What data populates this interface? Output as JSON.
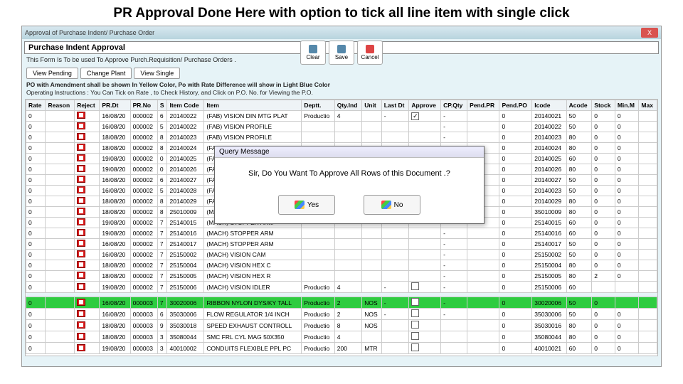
{
  "slide": {
    "title": "PR Approval Done Here with option to tick all line item with single click"
  },
  "titlebar": {
    "text": "Approval of Purchase Indent/ Purchase Order",
    "close": "X"
  },
  "form": {
    "header": "Purchase Indent Approval",
    "sub": "This Form Is To be used To Approve Purch.Requisition/ Purchase Orders .",
    "note1": "PO with Amendment shall be shown In Yellow Color, Po with Rate Difference will show in Light Blue Color",
    "note2": "Operating Instructions : You Can Tick on Rate , to Check History, and Click on P.O. No. for Viewing the P.O."
  },
  "toolbar": {
    "clear": "Clear",
    "save": "Save",
    "cancel": "Cancel"
  },
  "views": {
    "pending": "View Pending",
    "change": "Change Plant",
    "single": "View Single"
  },
  "dialog": {
    "title": "Query Message",
    "msg": "Sir, Do You Want To Approve All Rows of this Document .?",
    "yes": "Yes",
    "no": "No"
  },
  "cols": [
    "Rate",
    "Reason",
    "Reject",
    "PR.Dt",
    "PR.No",
    "S",
    "Item Code",
    "Item",
    "Deptt.",
    "Qty.Ind",
    "Unit",
    "Last Dt",
    "Approve",
    "CP.Qty",
    "Pend.PR",
    "Pend.PO",
    "Icode",
    "Acode",
    "Stock",
    "Min.M",
    "Max"
  ],
  "rows": [
    {
      "c": [
        "0",
        "",
        "",
        "16/08/20",
        "000002",
        "6",
        "20140022",
        "(FAB) VISION DIN MTG PLAT",
        "Productio",
        "4",
        "",
        "-",
        "✓",
        "-",
        "",
        "0",
        "20140021",
        "50",
        "0",
        "0",
        ""
      ]
    },
    {
      "c": [
        "0",
        "",
        "",
        "16/08/20",
        "000002",
        "5",
        "20140022",
        "(FAB) VISION PROFILE",
        "",
        "",
        "",
        "",
        "",
        "-",
        "",
        "0",
        "20140022",
        "50",
        "0",
        "0",
        ""
      ]
    },
    {
      "c": [
        "0",
        "",
        "",
        "18/08/20",
        "000002",
        "8",
        "20140023",
        "(FAB) VISION PROFILE",
        "",
        "",
        "",
        "",
        "",
        "-",
        "",
        "0",
        "20140023",
        "80",
        "0",
        "0",
        ""
      ]
    },
    {
      "c": [
        "0",
        "",
        "",
        "18/08/20",
        "000002",
        "8",
        "20140024",
        "(FAB) VISION RAIL 3L",
        "",
        "",
        "",
        "",
        "",
        "-",
        "",
        "0",
        "20140024",
        "80",
        "0",
        "0",
        ""
      ]
    },
    {
      "c": [
        "0",
        "",
        "",
        "19/08/20",
        "000002",
        "0",
        "20140025",
        "(FAB) VISION RAIL M",
        "",
        "",
        "",
        "",
        "",
        "-",
        "",
        "0",
        "20140025",
        "60",
        "0",
        "0",
        ""
      ]
    },
    {
      "c": [
        "0",
        "",
        "",
        "19/08/20",
        "000002",
        "0",
        "20140026",
        "(FAB) VISION SENSO",
        "",
        "",
        "",
        "",
        "",
        "-",
        "",
        "0",
        "20140026",
        "80",
        "0",
        "0",
        ""
      ]
    },
    {
      "c": [
        "0",
        "",
        "",
        "16/08/20",
        "000002",
        "6",
        "20140027",
        "(FAB) VISION SUN LT",
        "",
        "",
        "",
        "",
        "",
        "-",
        "",
        "0",
        "20140027",
        "50",
        "0",
        "0",
        ""
      ]
    },
    {
      "c": [
        "0",
        "",
        "",
        "16/08/20",
        "000002",
        "5",
        "20140028",
        "(FAB) VISION SUN RT",
        "",
        "",
        "",
        "",
        "",
        "-",
        "",
        "0",
        "20140023",
        "50",
        "0",
        "0",
        ""
      ]
    },
    {
      "c": [
        "0",
        "",
        "",
        "18/08/20",
        "000002",
        "8",
        "20140029",
        "(FAB) VISION TOP MN",
        "",
        "",
        "",
        "",
        "",
        "-",
        "",
        "0",
        "20140029",
        "80",
        "0",
        "0",
        ""
      ]
    },
    {
      "c": [
        "0",
        "",
        "",
        "18/08/20",
        "000002",
        "8",
        "25010009",
        "(MACH) REJECTION IG",
        "",
        "",
        "",
        "",
        "",
        "-",
        "",
        "0",
        "35010009",
        "80",
        "0",
        "0",
        ""
      ]
    },
    {
      "c": [
        "0",
        "",
        "",
        "19/08/20",
        "000002",
        "7",
        "25140015",
        "(MACH) STOPPER ARM",
        "",
        "",
        "",
        "",
        "",
        "-",
        "",
        "0",
        "25140015",
        "60",
        "0",
        "0",
        ""
      ]
    },
    {
      "c": [
        "0",
        "",
        "",
        "19/08/20",
        "000002",
        "7",
        "25140016",
        "(MACH) STOPPER ARM",
        "",
        "",
        "",
        "",
        "",
        "-",
        "",
        "0",
        "25140016",
        "60",
        "0",
        "0",
        ""
      ]
    },
    {
      "c": [
        "0",
        "",
        "",
        "16/08/20",
        "000002",
        "7",
        "25140017",
        "(MACH) STOPPER ARM",
        "",
        "",
        "",
        "",
        "",
        "-",
        "",
        "0",
        "25140017",
        "50",
        "0",
        "0",
        ""
      ]
    },
    {
      "c": [
        "0",
        "",
        "",
        "16/08/20",
        "000002",
        "7",
        "25150002",
        "(MACH) VISION CAM",
        "",
        "",
        "",
        "",
        "",
        "-",
        "",
        "0",
        "25150002",
        "50",
        "0",
        "0",
        ""
      ]
    },
    {
      "c": [
        "0",
        "",
        "",
        "18/08/20",
        "000002",
        "7",
        "25150004",
        "(MACH) VISION HEX C",
        "",
        "",
        "",
        "",
        "",
        "-",
        "",
        "0",
        "25150004",
        "80",
        "0",
        "0",
        ""
      ]
    },
    {
      "c": [
        "0",
        "",
        "",
        "18/08/20",
        "000002",
        "7",
        "25150005",
        "(MACH) VISION HEX R",
        "",
        "",
        "",
        "",
        "",
        "-",
        "",
        "0",
        "25150005",
        "80",
        "2",
        "0",
        ""
      ]
    },
    {
      "c": [
        "0",
        "",
        "",
        "19/08/20",
        "000002",
        "7",
        "25150006",
        "(MACH) VISION IDLER",
        "Productio",
        "4",
        "",
        "-",
        "□",
        "-",
        "",
        "0",
        "25150006",
        "60",
        "",
        "",
        ""
      ]
    },
    {
      "g": true
    },
    {
      "hl": true,
      "c": [
        "0",
        "",
        "",
        "16/08/20",
        "000003",
        "7",
        "30020006",
        "RIBBON NYLON DYS/KY TALL",
        "Productio",
        "2",
        "NOS",
        "-",
        "□",
        "-",
        "",
        "0",
        "30020006",
        "50",
        "0",
        "",
        ""
      ]
    },
    {
      "c": [
        "0",
        "",
        "",
        "16/08/20",
        "000003",
        "6",
        "35030006",
        "FLOW REGULATOR 1/4 INCH",
        "Productio",
        "2",
        "NOS",
        "-",
        "□",
        "-",
        "",
        "0",
        "35030006",
        "50",
        "0",
        "0",
        ""
      ]
    },
    {
      "c": [
        "0",
        "",
        "",
        "18/08/20",
        "000003",
        "9",
        "35030018",
        "SPEED EXHAUST CONTROLL",
        "Productio",
        "8",
        "NOS",
        "",
        "□",
        "",
        "",
        "0",
        "35030016",
        "80",
        "0",
        "0",
        ""
      ]
    },
    {
      "c": [
        "0",
        "",
        "",
        "18/08/20",
        "000003",
        "3",
        "35080044",
        "SMC FRL CYL MAG 50X350",
        "Productio",
        "4",
        "",
        "",
        "□",
        "",
        "",
        "0",
        "35080044",
        "80",
        "0",
        "0",
        ""
      ]
    },
    {
      "c": [
        "0",
        "",
        "",
        "19/08/20",
        "000003",
        "3",
        "40010002",
        "CONDUITS FLEXIBLE PPL PC",
        "Productio",
        "200",
        "MTR",
        "",
        "□",
        "",
        "",
        "0",
        "40010021",
        "60",
        "0",
        "0",
        ""
      ]
    }
  ]
}
